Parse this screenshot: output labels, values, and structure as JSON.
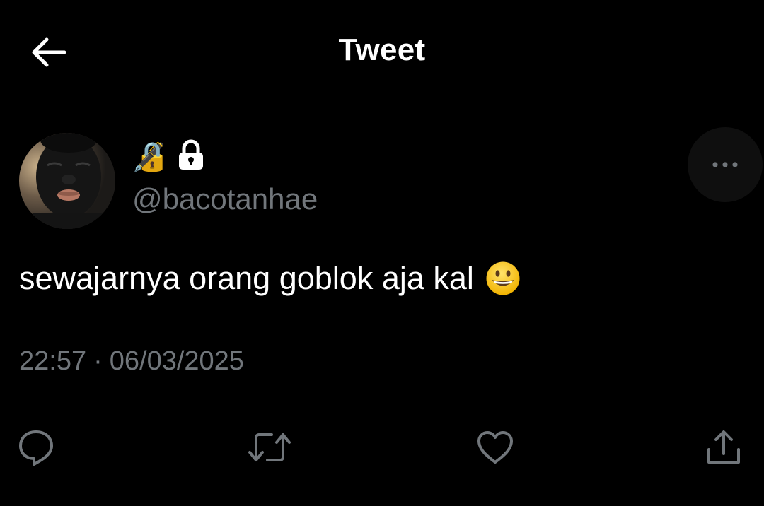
{
  "header": {
    "title": "Tweet"
  },
  "author": {
    "display_name_emojis": [
      "🔏",
      "🔒"
    ],
    "handle": "@bacotanhae"
  },
  "tweet": {
    "text": "sewajarnya orang goblok aja kal",
    "emoji": "grinning-face",
    "time": "22:57",
    "separator": "·",
    "date": "06/03/2025"
  },
  "actions": [
    {
      "name": "reply",
      "icon": "speech-bubble-icon"
    },
    {
      "name": "retweet",
      "icon": "retweet-icon"
    },
    {
      "name": "like",
      "icon": "heart-icon"
    },
    {
      "name": "share",
      "icon": "share-icon"
    }
  ],
  "colors": {
    "background": "#000000",
    "text": "#ffffff",
    "secondary_text": "#71767b",
    "divider": "#2f3336",
    "icon": "#71767b"
  }
}
